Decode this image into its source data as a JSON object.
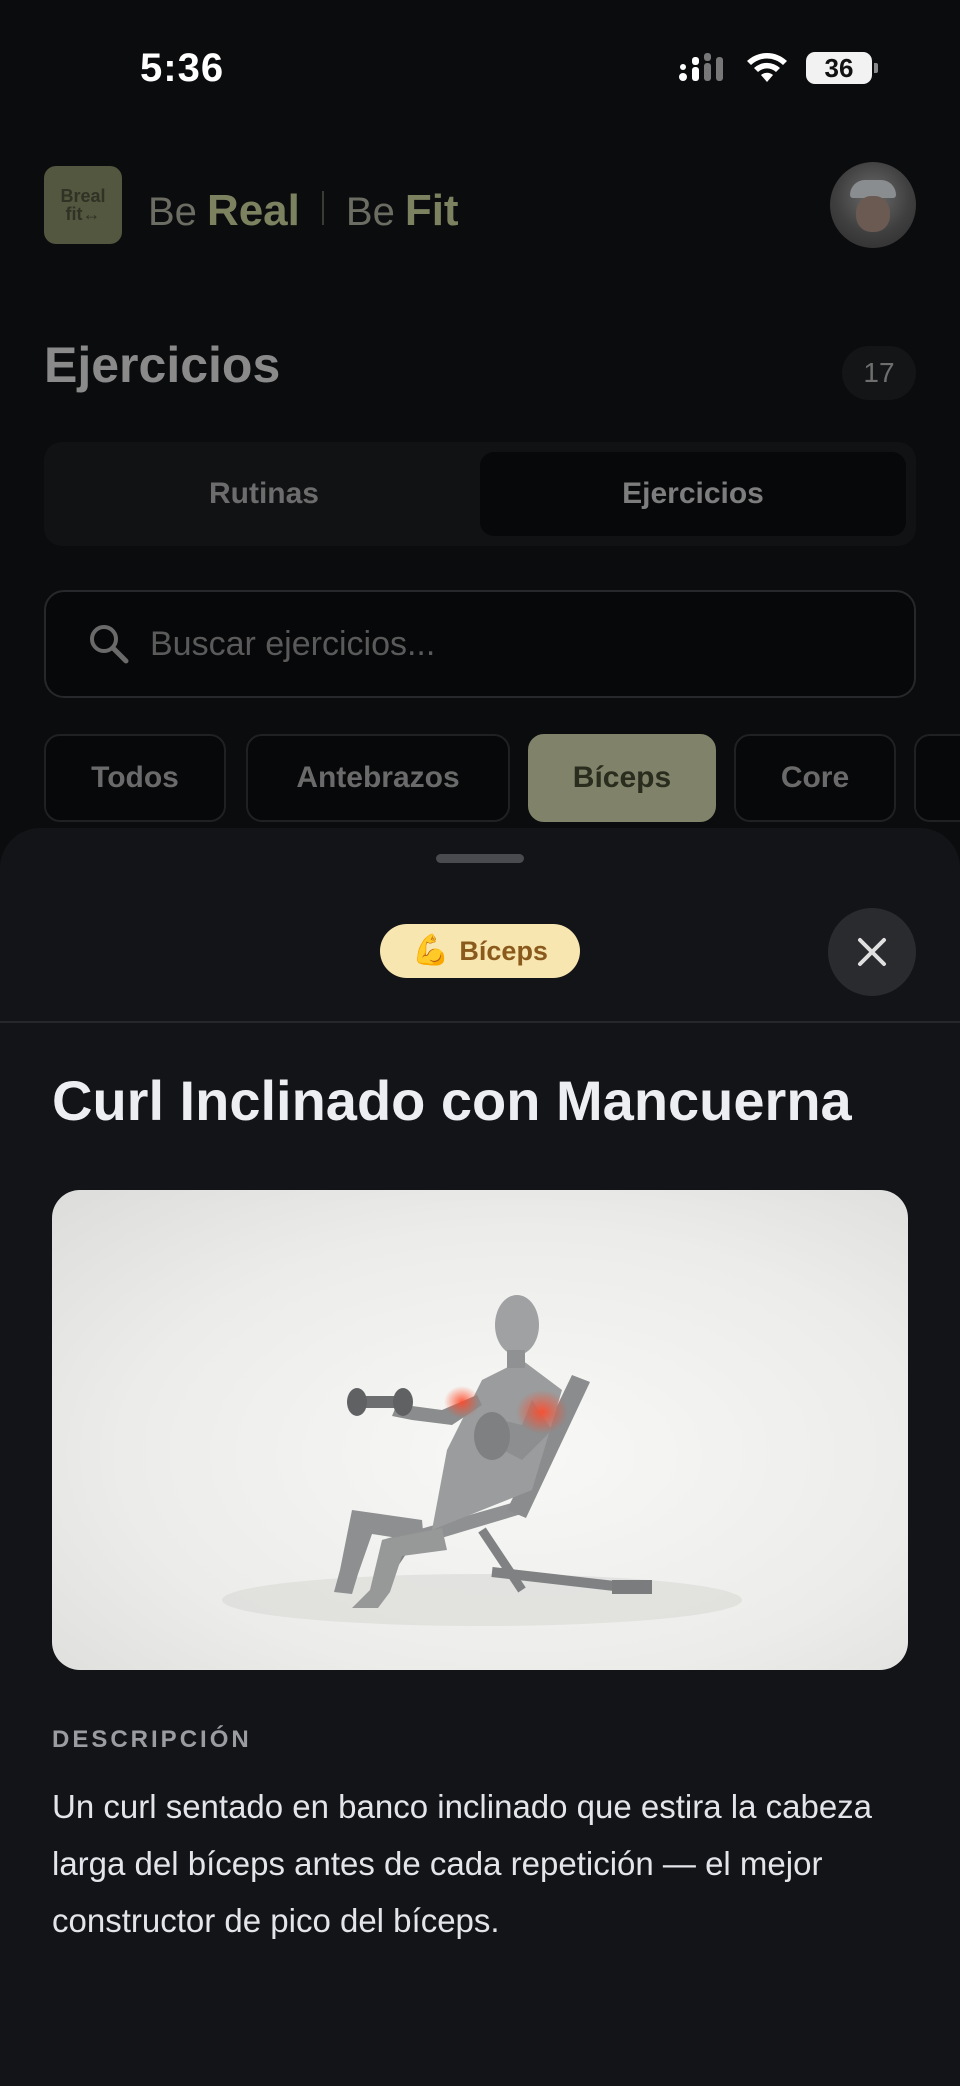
{
  "status_bar": {
    "time": "5:36",
    "battery": "36"
  },
  "header": {
    "logo_top": "Breal",
    "logo_bottom": "fit↔",
    "brand_be1": "Be",
    "brand_real": "Real",
    "brand_be2": "Be",
    "brand_fit": "Fit"
  },
  "page": {
    "title": "Ejercicios",
    "count": "17"
  },
  "segments": {
    "left": "Rutinas",
    "right": "Ejercicios"
  },
  "search": {
    "placeholder": "Buscar ejercicios..."
  },
  "filters": [
    {
      "label": "Todos"
    },
    {
      "label": "Antebrazos"
    },
    {
      "label": "Bíceps",
      "active": true
    },
    {
      "label": "Core"
    }
  ],
  "sheet": {
    "tag_emoji": "💪",
    "tag_label": "Bíceps",
    "exercise_title": "Curl Inclinado con Mancuerna",
    "description_heading": "DESCRIPCIÓN",
    "description": "Un curl sentado en banco inclinado que estira la cabeza larga del bíceps antes de cada repetición — el mejor constructor de pico del bíceps."
  },
  "colors": {
    "accent": "#80836a",
    "tag_bg": "#f8e6b0",
    "highlight": "#ff4a2a"
  }
}
